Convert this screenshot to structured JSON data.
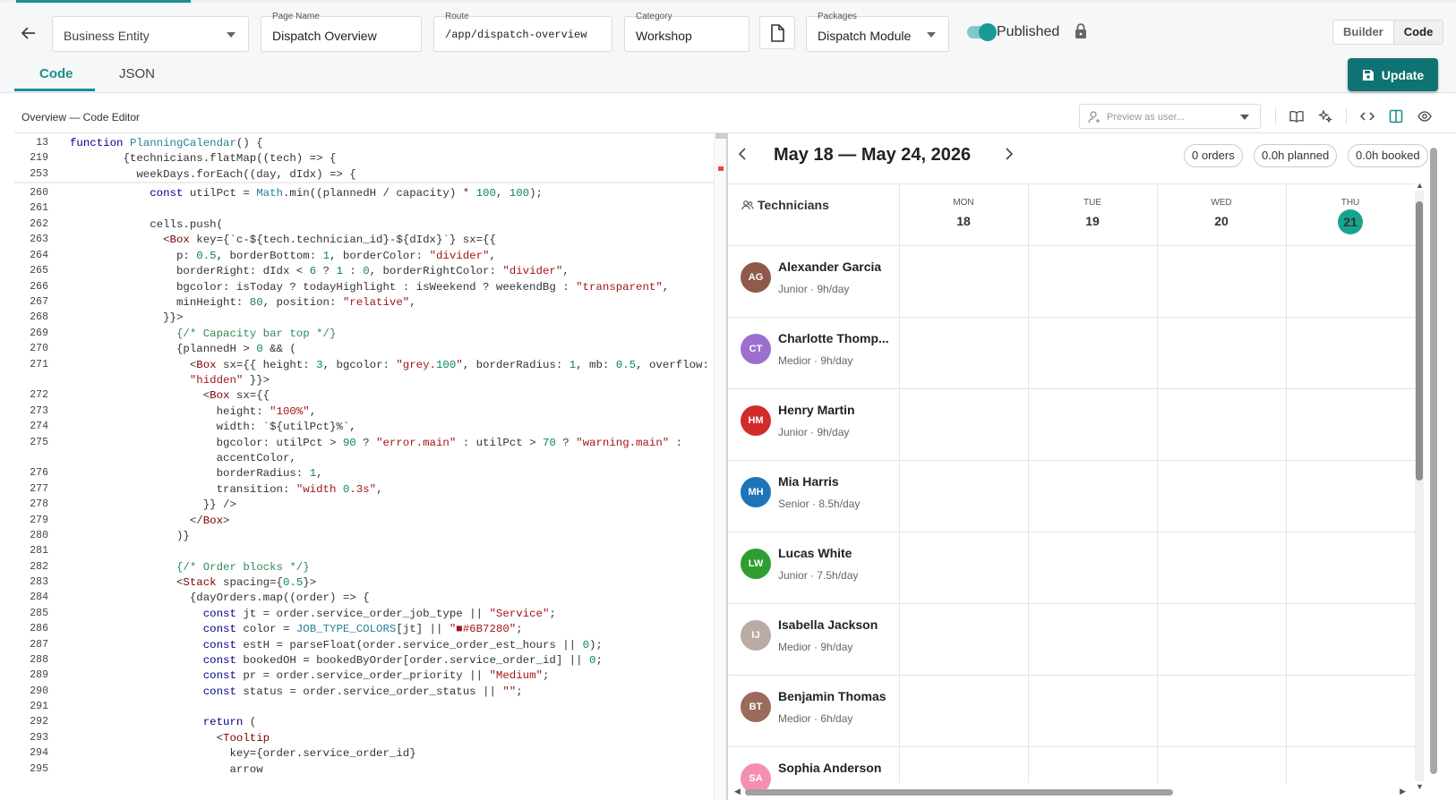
{
  "header": {
    "business_entity": "Business Entity",
    "page_name_label": "Page Name",
    "page_name": "Dispatch Overview",
    "route_label": "Route",
    "route": "/app/dispatch-overview",
    "category_label": "Category",
    "category": "Workshop",
    "packages_label": "Packages",
    "packages": "Dispatch Module",
    "published_label": "Published",
    "mode_builder": "Builder",
    "mode_code": "Code",
    "update_label": "Update"
  },
  "tabs": [
    "Code",
    "JSON"
  ],
  "toolbar": {
    "breadcrumb": "Overview — Code Editor",
    "preview_placeholder": "Preview as user..."
  },
  "code": [
    {
      "n": "13",
      "t": "function PlanningCalendar() {"
    },
    {
      "n": "219",
      "t": "        {technicians.flatMap((tech) => {"
    },
    {
      "n": "253",
      "t": "          weekDays.forEach((day, dIdx) => {"
    },
    {
      "n": "260",
      "t": "            const utilPct = Math.min((plannedH / capacity) * 100, 100);"
    },
    {
      "n": "261",
      "t": ""
    },
    {
      "n": "262",
      "t": "            cells.push("
    },
    {
      "n": "263",
      "t": "              <Box key={`c-${tech.technician_id}-${dIdx}`} sx={{"
    },
    {
      "n": "264",
      "t": "                p: 0.5, borderBottom: 1, borderColor: \"divider\","
    },
    {
      "n": "265",
      "t": "                borderRight: dIdx < 6 ? 1 : 0, borderRightColor: \"divider\","
    },
    {
      "n": "266",
      "t": "                bgcolor: isToday ? todayHighlight : isWeekend ? weekendBg : \"transparent\","
    },
    {
      "n": "267",
      "t": "                minHeight: 80, position: \"relative\","
    },
    {
      "n": "268",
      "t": "              }}>"
    },
    {
      "n": "269",
      "t": "                {/* Capacity bar top */}"
    },
    {
      "n": "270",
      "t": "                {plannedH > 0 && ("
    },
    {
      "n": "271",
      "t": "                  <Box sx={{ height: 3, bgcolor: \"grey.100\", borderRadius: 1, mb: 0.5, overflow:"
    },
    {
      "n": "",
      "t": "                  \"hidden\" }}>"
    },
    {
      "n": "272",
      "t": "                    <Box sx={{"
    },
    {
      "n": "273",
      "t": "                      height: \"100%\","
    },
    {
      "n": "274",
      "t": "                      width: `${utilPct}%`,"
    },
    {
      "n": "275",
      "t": "                      bgcolor: utilPct > 90 ? \"error.main\" : utilPct > 70 ? \"warning.main\" :"
    },
    {
      "n": "",
      "t": "                      accentColor,"
    },
    {
      "n": "276",
      "t": "                      borderRadius: 1,"
    },
    {
      "n": "277",
      "t": "                      transition: \"width 0.3s\","
    },
    {
      "n": "278",
      "t": "                    }} />"
    },
    {
      "n": "279",
      "t": "                  </Box>"
    },
    {
      "n": "280",
      "t": "                )}"
    },
    {
      "n": "281",
      "t": ""
    },
    {
      "n": "282",
      "t": "                {/* Order blocks */}"
    },
    {
      "n": "283",
      "t": "                <Stack spacing={0.5}>"
    },
    {
      "n": "284",
      "t": "                  {dayOrders.map((order) => {"
    },
    {
      "n": "285",
      "t": "                    const jt = order.service_order_job_type || \"Service\";"
    },
    {
      "n": "286",
      "t": "                    const color = JOB_TYPE_COLORS[jt] || \"■#6B7280\";"
    },
    {
      "n": "287",
      "t": "                    const estH = parseFloat(order.service_order_est_hours || 0);"
    },
    {
      "n": "288",
      "t": "                    const bookedOH = bookedByOrder[order.service_order_id] || 0;"
    },
    {
      "n": "289",
      "t": "                    const pr = order.service_order_priority || \"Medium\";"
    },
    {
      "n": "290",
      "t": "                    const status = order.service_order_status || \"\";"
    },
    {
      "n": "291",
      "t": ""
    },
    {
      "n": "292",
      "t": "                    return ("
    },
    {
      "n": "293",
      "t": "                      <Tooltip"
    },
    {
      "n": "294",
      "t": "                        key={order.service_order_id}"
    },
    {
      "n": "295",
      "t": "                        arrow"
    }
  ],
  "calendar": {
    "range": "May 18 — May 24, 2026",
    "orders": "0 orders",
    "planned": "0.0h planned",
    "booked": "0.0h booked",
    "tech_header": "Technicians",
    "days": [
      {
        "name": "MON",
        "num": "18",
        "today": false
      },
      {
        "name": "TUE",
        "num": "19",
        "today": false
      },
      {
        "name": "WED",
        "num": "20",
        "today": false
      },
      {
        "name": "THU",
        "num": "21",
        "today": true
      }
    ],
    "technicians": [
      {
        "initials": "AG",
        "name": "Alexander Garcia",
        "meta": "Junior · 9h/day",
        "color": "#8d5a4b"
      },
      {
        "initials": "CT",
        "name": "Charlotte Thomp...",
        "meta": "Medior · 9h/day",
        "color": "#9c6fcf"
      },
      {
        "initials": "HM",
        "name": "Henry Martin",
        "meta": "Junior · 9h/day",
        "color": "#d22b2b"
      },
      {
        "initials": "MH",
        "name": "Mia Harris",
        "meta": "Senior · 8.5h/day",
        "color": "#1f74b8"
      },
      {
        "initials": "LW",
        "name": "Lucas White",
        "meta": "Junior · 7.5h/day",
        "color": "#2e9d32"
      },
      {
        "initials": "IJ",
        "name": "Isabella Jackson",
        "meta": "Medior · 9h/day",
        "color": "#bcaaa4"
      },
      {
        "initials": "BT",
        "name": "Benjamin Thomas",
        "meta": "Medior · 6h/day",
        "color": "#9a6a5a"
      },
      {
        "initials": "SA",
        "name": "Sophia Anderson",
        "meta": "",
        "color": "#f48fb1"
      }
    ]
  }
}
